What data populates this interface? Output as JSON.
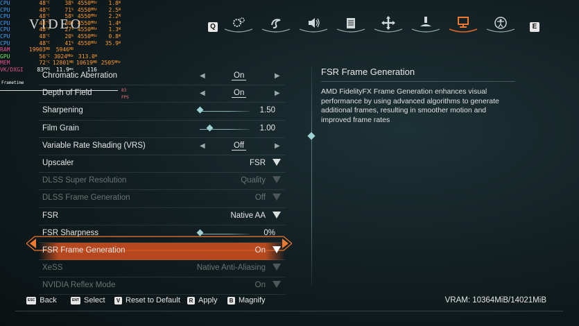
{
  "overlay": {
    "rows": [
      {
        "label": "CPU",
        "v1": "48",
        "u1": "°C",
        "v2": "38",
        "u2": "%",
        "v3": "4550",
        "u3": "MHz",
        "v4": "1.8",
        "u4": "W"
      },
      {
        "label": "CPU",
        "v1": "48",
        "u1": "°C",
        "v2": "71",
        "u2": "%",
        "v3": "4550",
        "u3": "MHz",
        "v4": "2.5",
        "u4": "W"
      },
      {
        "label": "CPU",
        "v1": "48",
        "u1": "°C",
        "v2": "58",
        "u2": "%",
        "v3": "4550",
        "u3": "MHz",
        "v4": "2.2",
        "u4": "W"
      },
      {
        "label": "CPU",
        "v1": "48",
        "u1": "°C",
        "v2": "30",
        "u2": "%",
        "v3": "4550",
        "u3": "MHz",
        "v4": "1.4",
        "u4": "W"
      },
      {
        "label": "CPU",
        "v1": "48",
        "u1": "°C",
        "v2": "27",
        "u2": "%",
        "v3": "4550",
        "u3": "MHz",
        "v4": "1.3",
        "u4": "W"
      },
      {
        "label": "CPU",
        "v1": "48",
        "u1": "°C",
        "v2": "20",
        "u2": "%",
        "v3": "4550",
        "u3": "MHz",
        "v4": "0.8",
        "u4": "W"
      },
      {
        "label": "CPU",
        "v1": "48",
        "u1": "°C",
        "v2": "41",
        "u2": "%",
        "v3": "4550",
        "u3": "MHz",
        "v4": "35.9",
        "u4": "W"
      },
      {
        "label": "RAM",
        "v1": "19903",
        "u1": "MB",
        "v2": "5946",
        "u2": "MB",
        "v3": "",
        "u3": "",
        "v4": "",
        "u4": ""
      },
      {
        "label": "GPU",
        "v1": "56",
        "u1": "°C",
        "v2": "3024",
        "u2": "MHz",
        "v3": "313.0",
        "u3": "W",
        "v4": "",
        "u4": ""
      },
      {
        "label": "MEM",
        "v1": "72",
        "u1": "°C",
        "v2": "12801",
        "u2": "MB",
        "v3": "10619",
        "u3": "MB",
        "v4": "2505",
        "u4": "MHz"
      },
      {
        "label": "VK/DXGI",
        "v1": "83",
        "u1": "FPS",
        "v2": "11.9",
        "u2": "ms",
        "v3": "116",
        "u3": "",
        "v4": "",
        "u4": ""
      }
    ],
    "frametime_label": "Frametime",
    "fps_tag": "83 FPS"
  },
  "title": "VIDEO",
  "tabs": {
    "left_key": "Q",
    "right_key": "E",
    "icons": [
      "gameplay-gears-icon",
      "swirl-icon",
      "audio-icon",
      "list-icon",
      "move-cross-icon",
      "figure-icon",
      "monitor-icon",
      "accessibility-icon"
    ],
    "active_index": 6
  },
  "settings": [
    {
      "label": "Chromatic Aberration",
      "type": "toggle",
      "value": "On",
      "dim": false
    },
    {
      "label": "Depth of Field",
      "type": "toggle",
      "value": "On",
      "dim": false
    },
    {
      "label": "Sharpening",
      "type": "slider",
      "value": "1.50",
      "level": 0.0,
      "dim": false
    },
    {
      "label": "Film Grain",
      "type": "slider",
      "value": "1.00",
      "level": 0.2,
      "dim": false
    },
    {
      "label": "Variable Rate Shading (VRS)",
      "type": "toggle",
      "value": "Off",
      "dim": false
    },
    {
      "label": "Upscaler",
      "type": "dropdown",
      "value": "FSR",
      "dim": false
    },
    {
      "label": "DLSS Super Resolution",
      "type": "dropdown",
      "value": "Quality",
      "dim": true
    },
    {
      "label": "DLSS Frame Generation",
      "type": "dropdown",
      "value": "Off",
      "dim": true
    },
    {
      "label": "FSR",
      "type": "dropdown",
      "value": "Native AA",
      "dim": false
    },
    {
      "label": "FSR Sharpness",
      "type": "slider",
      "value": "0%",
      "level": 0.0,
      "dim": false
    },
    {
      "label": "FSR Frame Generation",
      "type": "dropdown",
      "value": "On",
      "dim": false,
      "selected": true
    },
    {
      "label": "XeSS",
      "type": "dropdown",
      "value": "Native Anti-Aliasing",
      "dim": true
    },
    {
      "label": "NVIDIA Reflex Mode",
      "type": "dropdown",
      "value": "On",
      "dim": true
    }
  ],
  "description": {
    "title": "FSR Frame Generation",
    "body": "AMD FidelityFX Frame Generation enhances visual performance by using advanced algorithms to generate additional frames, resulting in smoother motion and improved frame rates"
  },
  "footer": {
    "back": {
      "key": "ESC",
      "label": "Back"
    },
    "select": {
      "key": "ENT",
      "label": "Select"
    },
    "reset": {
      "key": "V",
      "label": "Reset to Default"
    },
    "apply": {
      "key": "R",
      "label": "Apply"
    },
    "magnify": {
      "key": "B",
      "label": "Magnify"
    },
    "vram": "VRAM: 10364MiB/14021MiB"
  },
  "colors": {
    "accent": "#d2501e",
    "cyan": "#9fd2d2"
  }
}
